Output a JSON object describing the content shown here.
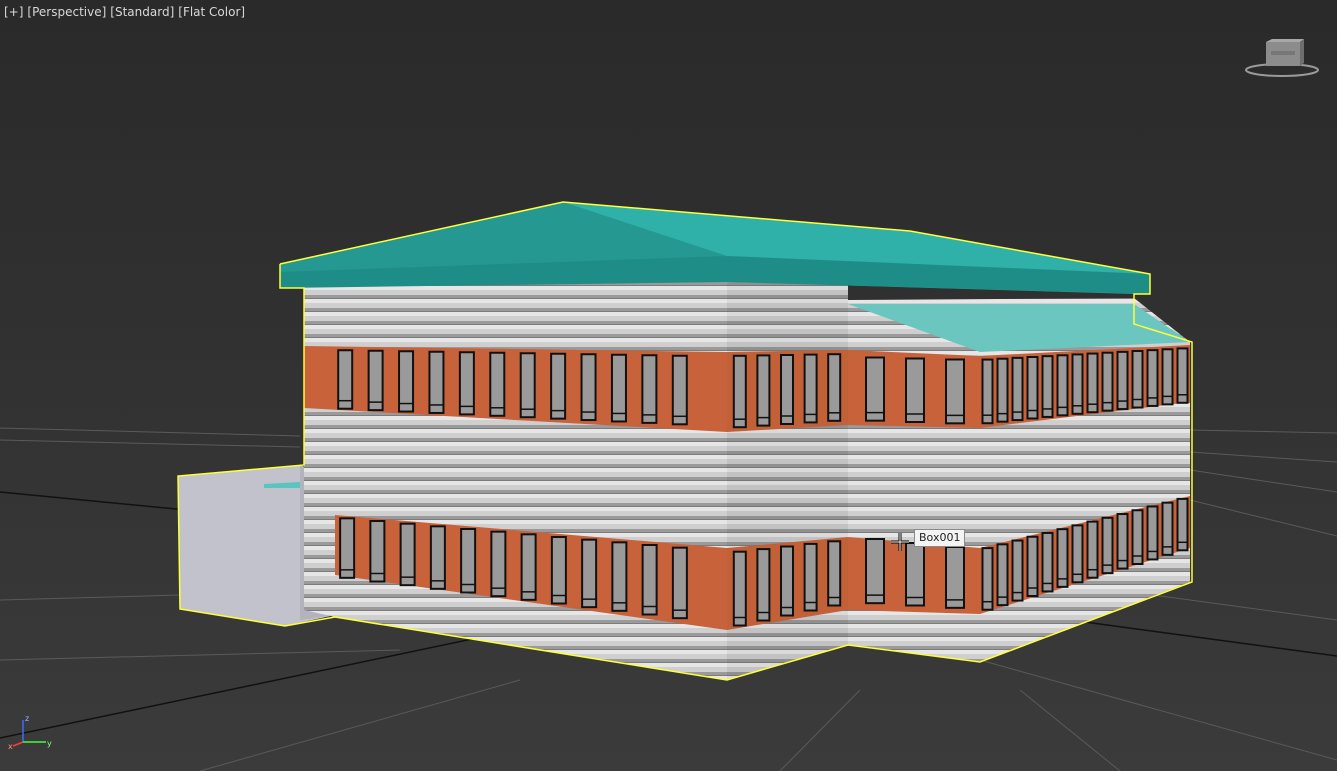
{
  "viewport": {
    "labels": [
      "[+]",
      "[Perspective]",
      "[Standard]",
      "[Flat Color]"
    ]
  },
  "tooltip": {
    "object_name": "Box001"
  },
  "viewcube": {
    "icon": "viewcube-icon"
  },
  "axis": {
    "x": "x",
    "y": "y",
    "z": "z"
  },
  "colors": {
    "background": "#2b2b2b",
    "roof": "#27a19a",
    "roof_light": "#6cc6c0",
    "brick": "#c8623a",
    "siding": "#c9c9c9",
    "selection": "#ffff3a"
  }
}
